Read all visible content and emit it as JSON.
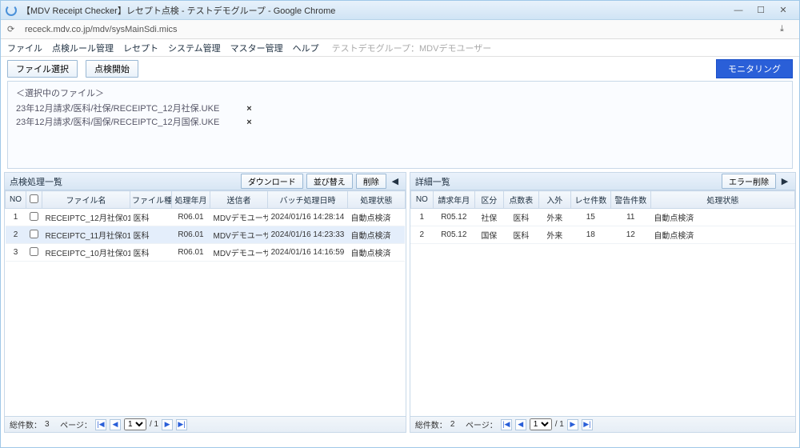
{
  "window": {
    "title": "【MDV Receipt Checker】レセプト点検 - テストデモグループ - Google Chrome"
  },
  "address": {
    "url": "receck.mdv.co.jp/mdv/sysMainSdi.mics"
  },
  "menu": {
    "file": "ファイル",
    "rules": "点検ルール管理",
    "receipt": "レセプト",
    "system": "システム管理",
    "master": "マスター管理",
    "help": "ヘルプ",
    "group": "テストデモグループ：MDVデモユーザー"
  },
  "toolbar": {
    "select_file": "ファイル選択",
    "start_check": "点検開始",
    "monitor": "モニタリング"
  },
  "filebox": {
    "caption": "＜選択中のファイル＞",
    "files": [
      "23年12月請求/医科/社保/RECEIPTC_12月社保.UKE",
      "23年12月請求/医科/国保/RECEIPTC_12月国保.UKE"
    ]
  },
  "left": {
    "title": "点検処理一覧",
    "btn_download": "ダウンロード",
    "btn_sort": "並び替え",
    "btn_delete": "削除",
    "cols": {
      "no": "NO",
      "file": "ファイル名",
      "kind": "ファイル種別",
      "ym": "処理年月",
      "sender": "送信者",
      "batch": "バッチ処理日時",
      "status": "処理状態"
    },
    "rows": [
      {
        "no": "1",
        "file": "RECEIPTC_12月社保01",
        "kind": "医科",
        "ym": "R06.01",
        "sender": "MDVデモユーザー",
        "batch": "2024/01/16 14:28:14",
        "status": "自動点検済"
      },
      {
        "no": "2",
        "file": "RECEIPTC_11月社保01",
        "kind": "医科",
        "ym": "R06.01",
        "sender": "MDVデモユーザー",
        "batch": "2024/01/16 14:23:33",
        "status": "自動点検済"
      },
      {
        "no": "3",
        "file": "RECEIPTC_10月社保01",
        "kind": "医科",
        "ym": "R06.01",
        "sender": "MDVデモユーザー",
        "batch": "2024/01/16 14:16:59",
        "status": "自動点検済"
      }
    ],
    "pager": {
      "total_label": "総件数：",
      "total": "3",
      "page_label": "ページ：",
      "page": "1",
      "of": "/ 1"
    }
  },
  "right": {
    "title": "詳細一覧",
    "btn_err_del": "エラー削除",
    "cols": {
      "no": "NO",
      "ym": "請求年月",
      "kubun": "区分",
      "table": "点数表",
      "inout": "入外",
      "rece": "レセ件数",
      "warn": "警告件数",
      "status": "処理状態"
    },
    "rows": [
      {
        "no": "1",
        "ym": "R05.12",
        "kubun": "社保",
        "table": "医科",
        "inout": "外来",
        "rece": "15",
        "warn": "11",
        "status": "自動点検済"
      },
      {
        "no": "2",
        "ym": "R05.12",
        "kubun": "国保",
        "table": "医科",
        "inout": "外来",
        "rece": "18",
        "warn": "12",
        "status": "自動点検済"
      }
    ],
    "pager": {
      "total_label": "総件数：",
      "total": "2",
      "page_label": "ページ：",
      "page": "1",
      "of": "/ 1"
    }
  }
}
